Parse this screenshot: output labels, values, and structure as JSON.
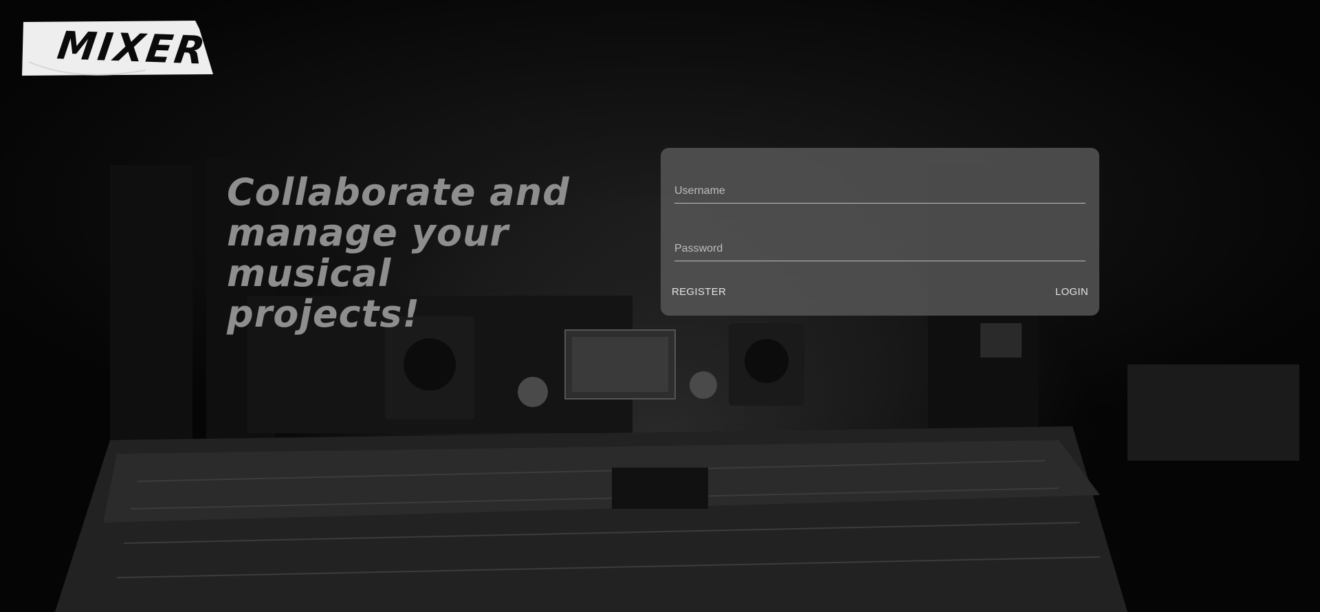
{
  "logo": {
    "text": "MIXER"
  },
  "hero": {
    "tagline_line1": "Collaborate and",
    "tagline_line2": "manage your musical",
    "tagline_line3": "projects!"
  },
  "login_form": {
    "username_placeholder": "Username",
    "password_placeholder": "Password",
    "register_label": "REGISTER",
    "login_label": "LOGIN"
  },
  "colors": {
    "background": "#000000",
    "card": "#585858",
    "tagline": "#8e8e8e",
    "logo_tape": "#eeeeee"
  }
}
